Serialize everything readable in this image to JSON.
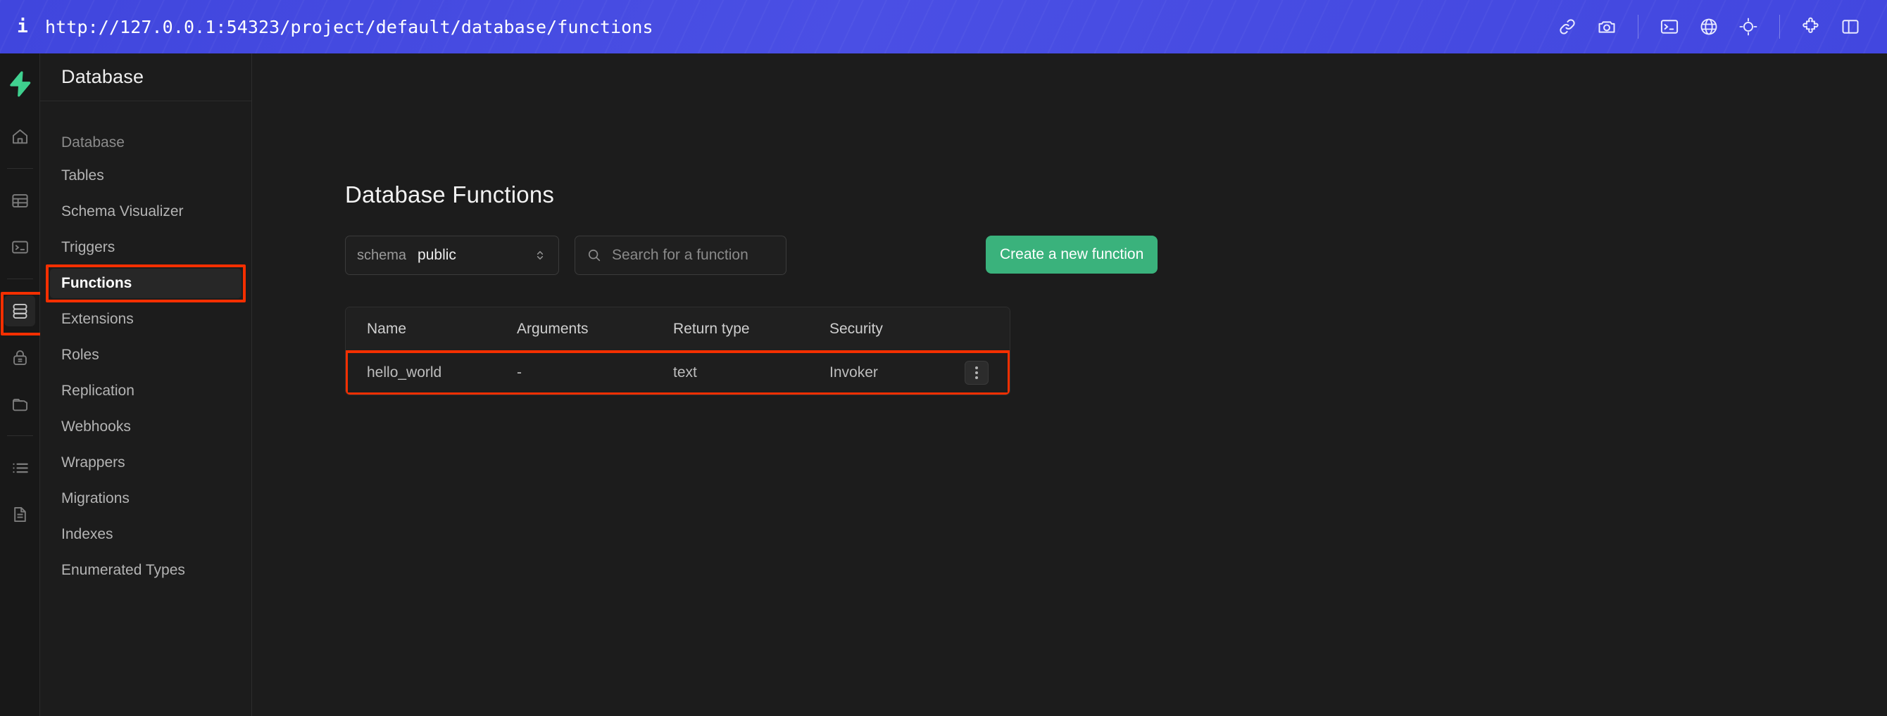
{
  "browser": {
    "info_icon": "info-icon",
    "url": "http://127.0.0.1:54323/project/default/database/functions",
    "actions": [
      {
        "name": "link-icon",
        "glyph": "link"
      },
      {
        "name": "camera-icon",
        "glyph": "camera"
      },
      {
        "name": "terminal-icon",
        "glyph": "terminal"
      },
      {
        "name": "globe-icon",
        "glyph": "globe"
      },
      {
        "name": "crosshair-icon",
        "glyph": "crosshair"
      },
      {
        "name": "puzzle-icon",
        "glyph": "puzzle"
      },
      {
        "name": "split-panel-icon",
        "glyph": "panel"
      }
    ]
  },
  "rail": {
    "logo": "supabase-logo",
    "items": [
      {
        "name": "home-icon",
        "label": "Home"
      },
      {
        "name": "table-editor-icon",
        "label": "Table Editor"
      },
      {
        "name": "sql-editor-icon",
        "label": "SQL Editor"
      },
      {
        "name": "database-icon",
        "label": "Database"
      },
      {
        "name": "authentication-icon",
        "label": "Authentication"
      },
      {
        "name": "storage-icon",
        "label": "Storage"
      },
      {
        "name": "logs-icon",
        "label": "Logs"
      },
      {
        "name": "api-docs-icon",
        "label": "API Docs"
      }
    ]
  },
  "nav": {
    "title": "Database",
    "group_label": "Database",
    "items": [
      {
        "label": "Tables",
        "active": false
      },
      {
        "label": "Schema Visualizer",
        "active": false
      },
      {
        "label": "Triggers",
        "active": false
      },
      {
        "label": "Functions",
        "active": true
      },
      {
        "label": "Extensions",
        "active": false
      },
      {
        "label": "Roles",
        "active": false
      },
      {
        "label": "Replication",
        "active": false
      },
      {
        "label": "Webhooks",
        "active": false
      },
      {
        "label": "Wrappers",
        "active": false
      },
      {
        "label": "Migrations",
        "active": false
      },
      {
        "label": "Indexes",
        "active": false
      },
      {
        "label": "Enumerated Types",
        "active": false
      }
    ]
  },
  "main": {
    "page_title": "Database Functions",
    "schema": {
      "label": "schema",
      "value": "public"
    },
    "search": {
      "placeholder": "Search for a function",
      "value": ""
    },
    "create_button": "Create a new function",
    "table": {
      "columns": [
        "Name",
        "Arguments",
        "Return type",
        "Security"
      ],
      "rows": [
        {
          "name": "hello_world",
          "arguments": "-",
          "return_type": "text",
          "security": "Invoker"
        }
      ]
    }
  },
  "annotations": {
    "highlight_color": "#f42f00",
    "boxes": [
      "database-rail-icon",
      "functions-nav-item",
      "functions-table-row"
    ]
  }
}
